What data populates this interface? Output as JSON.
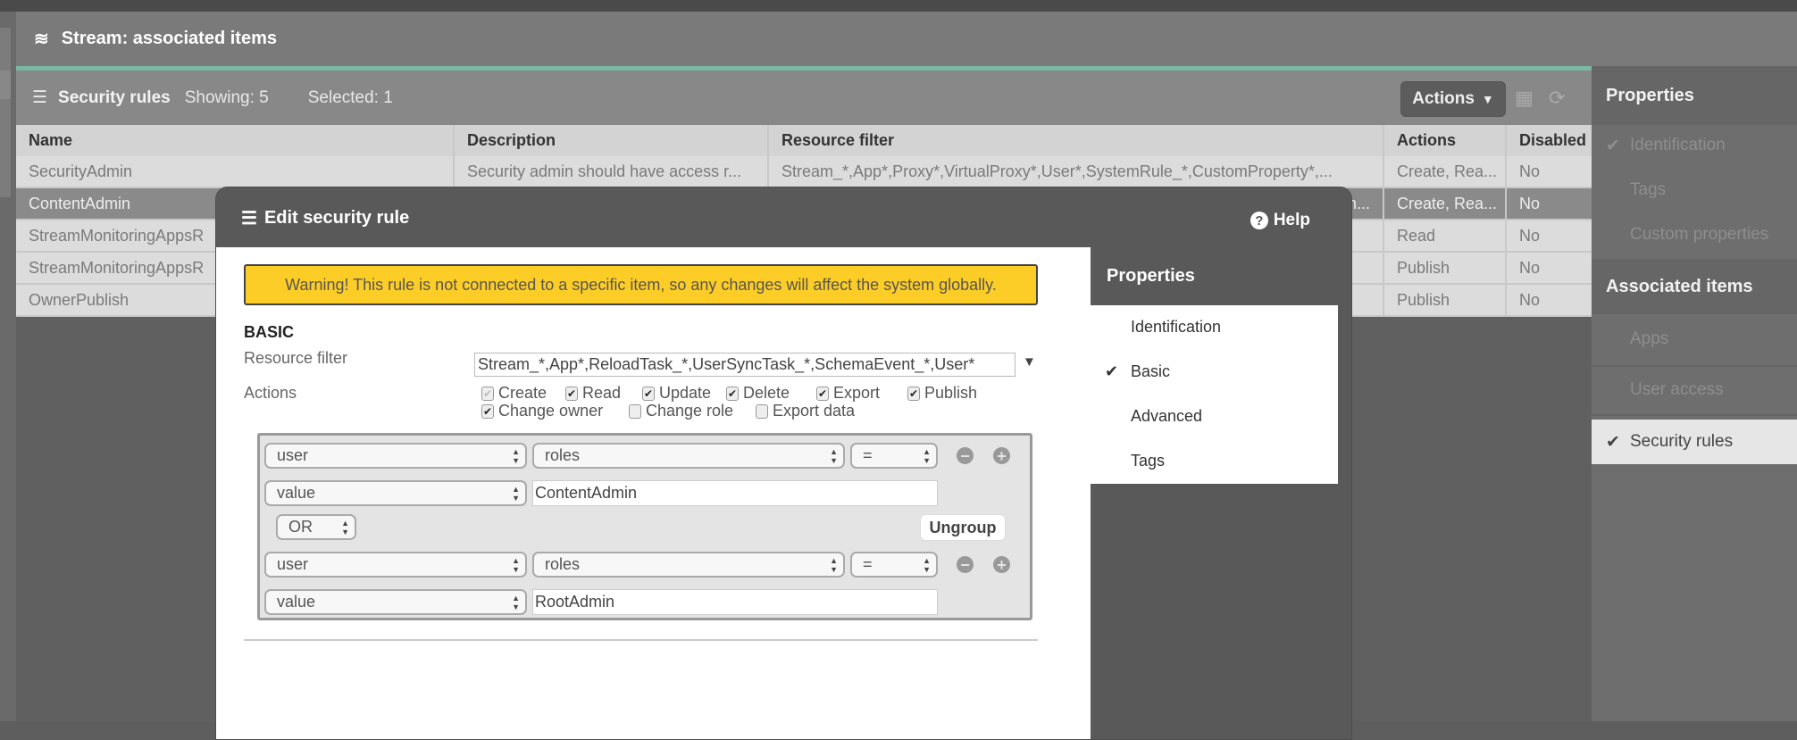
{
  "header": {
    "title": "Stream: associated items",
    "icon": "stream-icon"
  },
  "toolbar": {
    "title": "Security rules",
    "showing": "Showing:  5",
    "selected": "Selected: 1",
    "actions_label": "Actions",
    "actions_arrow": "▼"
  },
  "table": {
    "columns": [
      "Name",
      "Description",
      "Resource filter",
      "Actions",
      "Disabled"
    ],
    "rows": [
      [
        "SecurityAdmin",
        "Security admin should have access r...",
        "Stream_*,App*,Proxy*,VirtualProxy*,User*,SystemRule_*,CustomProperty*,...",
        "Create, Rea...",
        "No"
      ],
      [
        "ContentAdmin",
        "",
        "m...",
        "Create, Rea...",
        "No"
      ],
      [
        "StreamMonitoringAppsR",
        "",
        "",
        "Read",
        "No"
      ],
      [
        "StreamMonitoringAppsR",
        "",
        "",
        "Publish",
        "No"
      ],
      [
        "OwnerPublish",
        "",
        "",
        "Publish",
        "No"
      ]
    ],
    "selected_row": 1
  },
  "right_panel": {
    "properties_title": "Properties",
    "properties_items": [
      "Identification",
      "Tags",
      "Custom properties"
    ],
    "associated_title": "Associated items",
    "associated_items": [
      "Apps",
      "User access",
      "Security rules"
    ],
    "selected": "Security rules"
  },
  "modal": {
    "title": "Edit security rule",
    "help": "Help",
    "warning": "Warning! This rule is not connected to a specific item, so any changes will affect the system globally.",
    "section": "BASIC",
    "resource_filter_label": "Resource filter",
    "resource_filter_value": "Stream_*,App*,ReloadTask_*,UserSyncTask_*,SchemaEvent_*,User*",
    "actions_label": "Actions",
    "actions": [
      {
        "label": "Create",
        "checked": true,
        "disabled": true
      },
      {
        "label": "Read",
        "checked": true
      },
      {
        "label": "Update",
        "checked": true
      },
      {
        "label": "Delete",
        "checked": true
      },
      {
        "label": "Export",
        "checked": true
      },
      {
        "label": "Publish",
        "checked": true
      },
      {
        "label": "Change owner",
        "checked": true
      },
      {
        "label": "Change role",
        "checked": false
      },
      {
        "label": "Export data",
        "checked": false
      }
    ],
    "conditions": [
      {
        "object": "user",
        "property": "roles",
        "operator": "=",
        "value_type": "value",
        "value": "ContentAdmin"
      },
      {
        "object": "user",
        "property": "roles",
        "operator": "=",
        "value_type": "value",
        "value": "RootAdmin"
      }
    ],
    "join": "OR",
    "ungroup": "Ungroup",
    "properties_title": "Properties",
    "properties_items": [
      "Identification",
      "Basic",
      "Advanced",
      "Tags"
    ],
    "properties_selected": "Basic"
  },
  "colors": {
    "accent": "#7ab8a2",
    "warning": "#fdcd27"
  }
}
